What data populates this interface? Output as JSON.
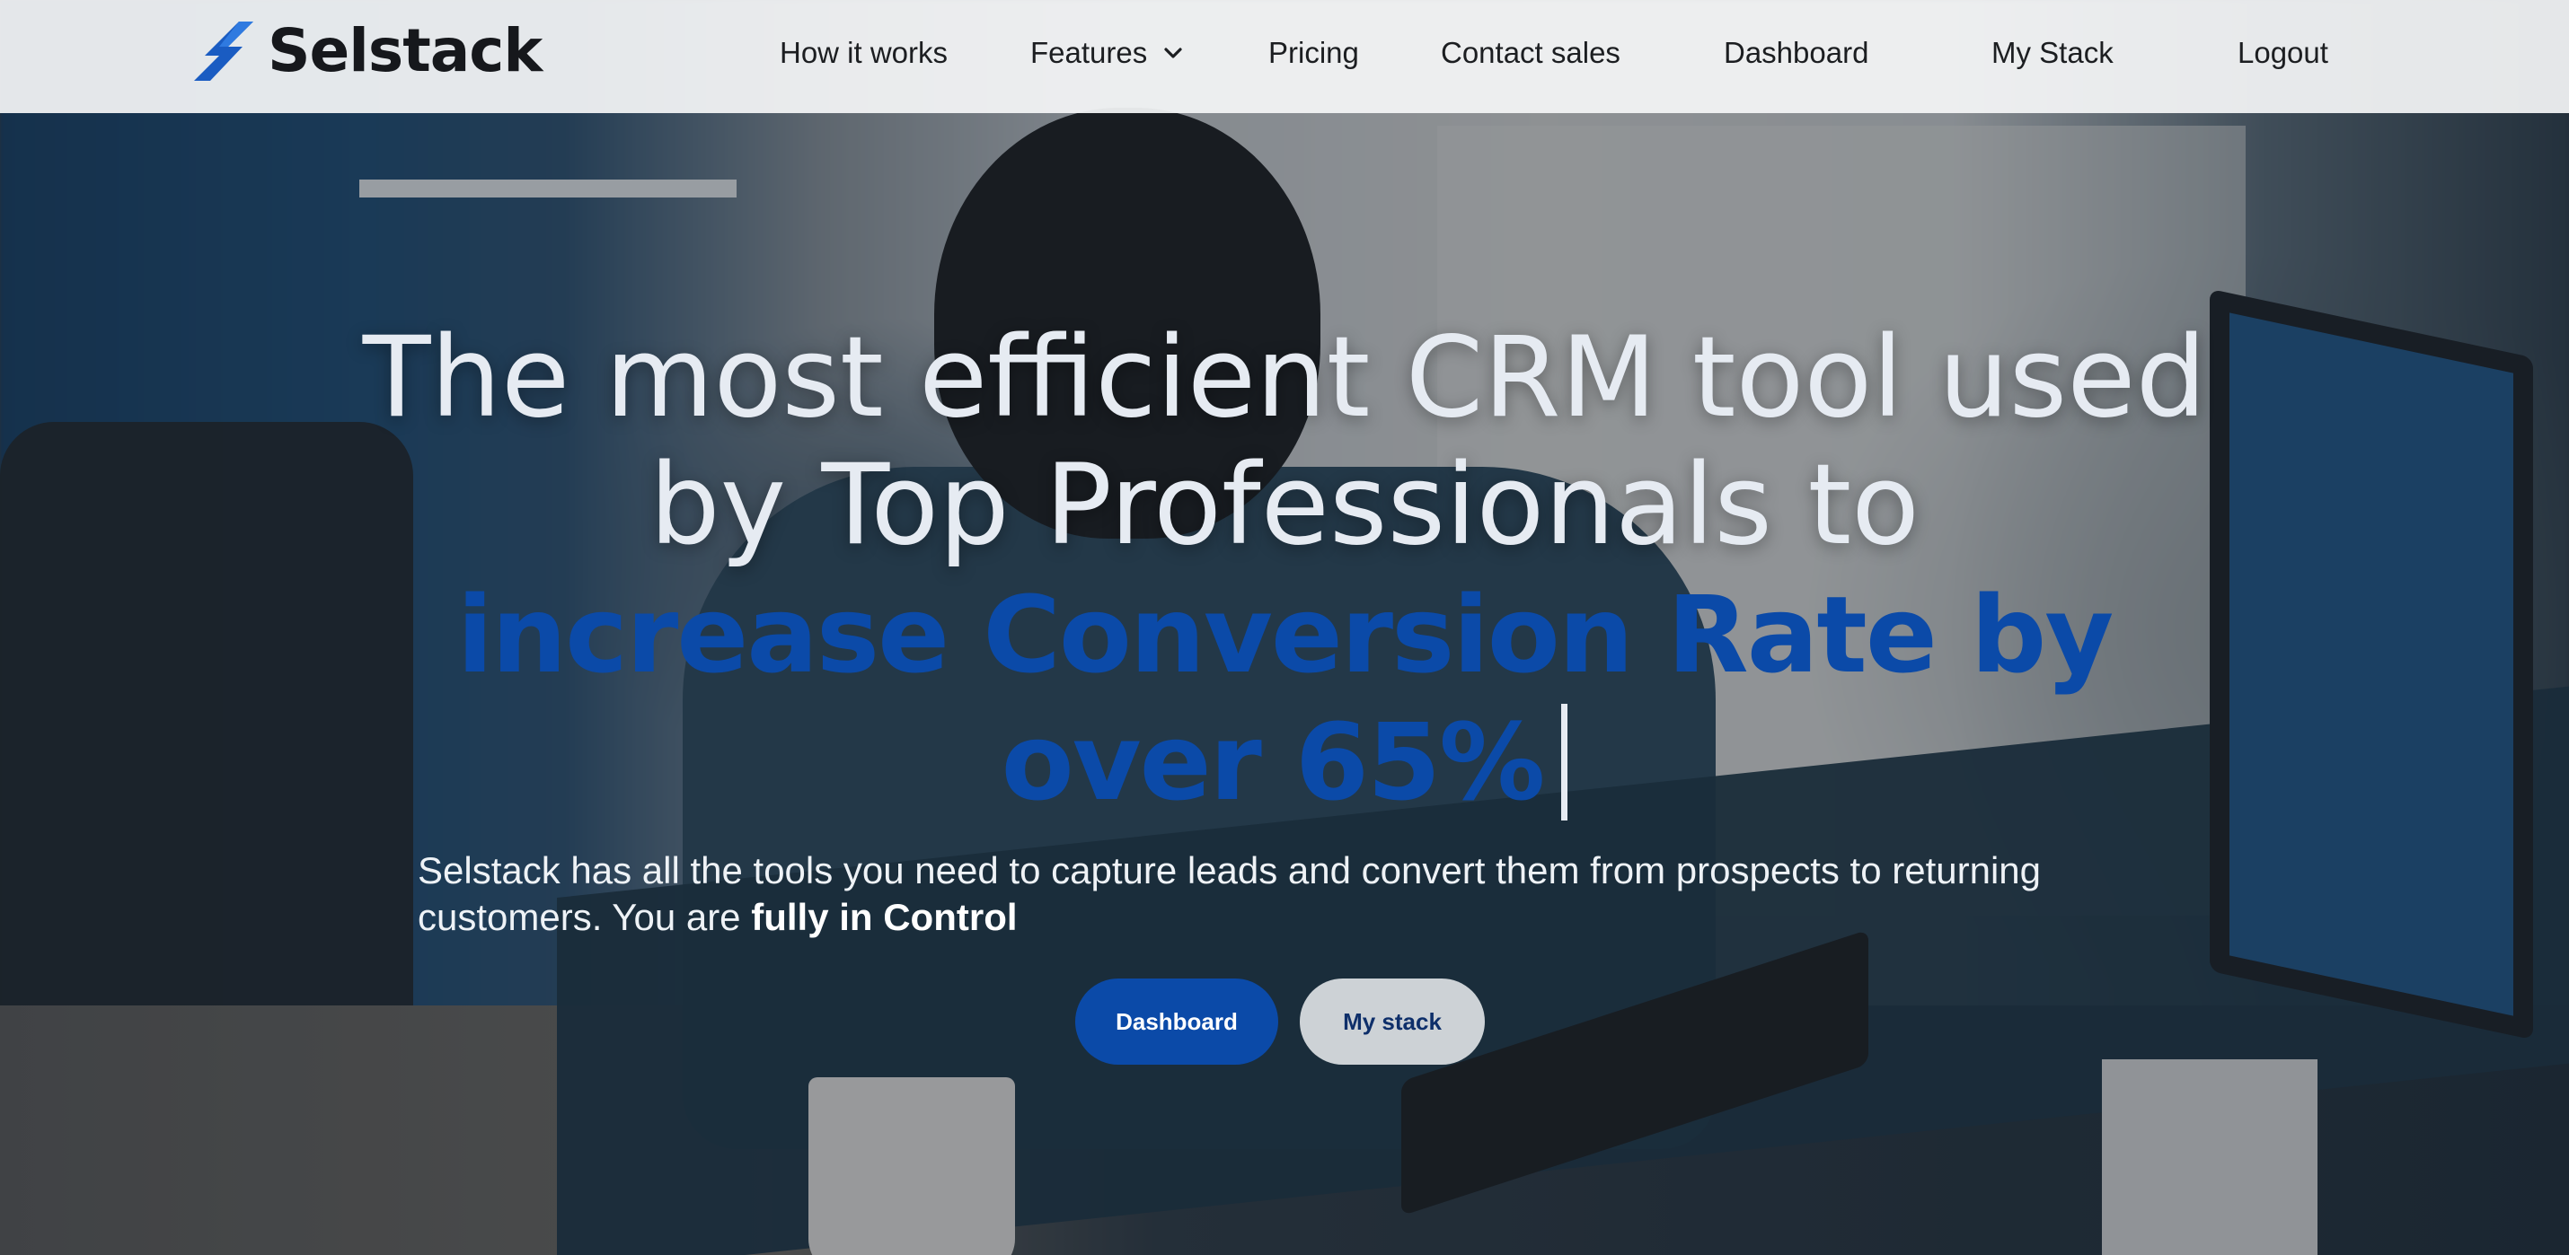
{
  "brand": {
    "name": "Selstack",
    "accent_color": "#0b4aa8"
  },
  "nav": {
    "items": [
      {
        "label": "How it works"
      },
      {
        "label": "Features",
        "icon": "chevron-down-icon"
      },
      {
        "label": "Pricing"
      },
      {
        "label": "Contact sales"
      },
      {
        "label": "Dashboard"
      },
      {
        "label": "My Stack"
      },
      {
        "label": "Logout"
      }
    ]
  },
  "hero": {
    "title_line1": "The most efficient CRM tool used",
    "title_line2": "by Top Professionals to",
    "accent_line1": "increase Conversion Rate by",
    "accent_line2": "over 65%",
    "subtitle_prefix": "Selstack has all the tools you need to capture leads and convert them from prospects to returning customers. You are ",
    "subtitle_bold": "fully in Control",
    "primary_button": "Dashboard",
    "secondary_button": "My stack"
  }
}
